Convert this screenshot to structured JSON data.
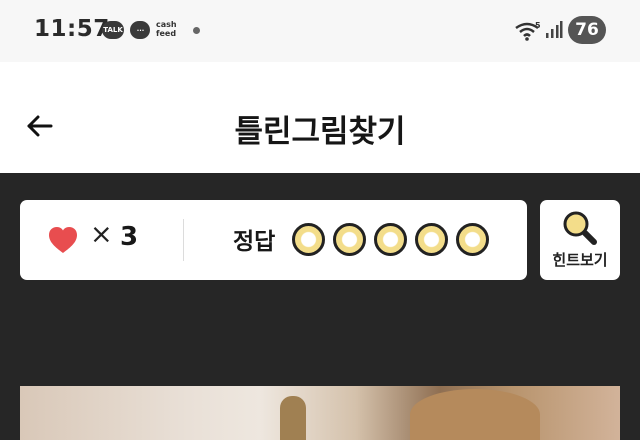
{
  "status_bar": {
    "time": "11:57",
    "talk_label": "TALK",
    "chat_glyph": "...",
    "cashfeed_line1": "cash",
    "cashfeed_line2": "feed",
    "wifi_badge": "5",
    "battery": "76"
  },
  "header": {
    "back_icon": "arrow-left-icon",
    "title": "틀린그림찾기"
  },
  "game": {
    "heart_icon": "heart-icon",
    "times_symbol": "×",
    "lives": "3",
    "answer_label": "정답",
    "answer_slots": [
      {
        "found": false
      },
      {
        "found": false
      },
      {
        "found": false
      },
      {
        "found": false
      },
      {
        "found": false
      }
    ],
    "hint_icon": "magnifier-icon",
    "hint_label": "힌트보기"
  },
  "colors": {
    "background_dark": "#262626",
    "panel": "#ffffff",
    "heart": "#e84d4f",
    "slot_fill": "#f3dd8a",
    "slot_outline": "#222222"
  }
}
